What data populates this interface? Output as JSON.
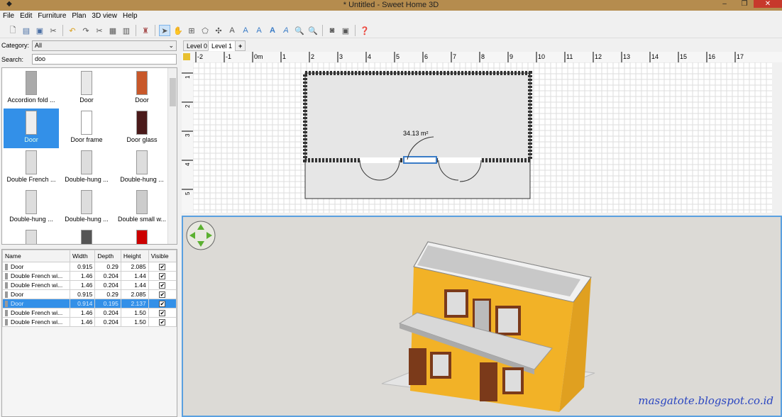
{
  "window": {
    "title": "* Untitled - Sweet Home 3D",
    "min": "–",
    "max": "❐",
    "close": "✕"
  },
  "menu": [
    "File",
    "Edit",
    "Furniture",
    "Plan",
    "3D view",
    "Help"
  ],
  "toolbar": [
    "new-icon",
    "open-icon",
    "save-icon",
    "cut-prefs-icon",
    "undo-icon",
    "redo-icon",
    "cut-icon",
    "copy-icon",
    "paste-icon",
    "add-furniture-icon",
    "select-icon",
    "pan-icon",
    "create-walls-icon",
    "create-rooms-icon",
    "create-dimensions-icon",
    "add-text-icon",
    "text-style-icon",
    "increase-text-icon",
    "bold-icon",
    "italic-icon",
    "zoom-in-icon",
    "zoom-out-icon",
    "photo-icon",
    "video-icon",
    "help-icon"
  ],
  "catalog": {
    "category_label": "Category:",
    "category_value": "All",
    "search_label": "Search:",
    "search_value": "doo",
    "items": [
      "Accordion fold ...",
      "Door",
      "Door",
      "Door",
      "Door frame",
      "Door glass",
      "Double French ...",
      "Double-hung ...",
      "Double-hung ...",
      "Double-hung ...",
      "Double-hung ...",
      "Double small w..."
    ],
    "selected_index": 3
  },
  "furniture_table": {
    "columns": [
      "Name",
      "Width",
      "Depth",
      "Height",
      "Visible"
    ],
    "rows": [
      {
        "name": "Door",
        "width": "0.915",
        "depth": "0.29",
        "height": "2.085",
        "visible": true
      },
      {
        "name": "Double French wi...",
        "width": "1.46",
        "depth": "0.204",
        "height": "1.44",
        "visible": true
      },
      {
        "name": "Double French wi...",
        "width": "1.46",
        "depth": "0.204",
        "height": "1.44",
        "visible": true
      },
      {
        "name": "Door",
        "width": "0.915",
        "depth": "0.29",
        "height": "2.085",
        "visible": true
      },
      {
        "name": "Door",
        "width": "0.914",
        "depth": "0.195",
        "height": "2.137",
        "visible": true
      },
      {
        "name": "Double French wi...",
        "width": "1.46",
        "depth": "0.204",
        "height": "1.50",
        "visible": true
      },
      {
        "name": "Double French wi...",
        "width": "1.46",
        "depth": "0.204",
        "height": "1.50",
        "visible": true
      }
    ],
    "selected_index": 4
  },
  "plan": {
    "tabs": [
      "Level 0",
      "Level 1"
    ],
    "active_tab": 1,
    "add_tab": "+",
    "ruler_x": [
      "-2",
      "-1",
      "0m",
      "1",
      "2",
      "3",
      "4",
      "5",
      "6",
      "7",
      "8",
      "9",
      "10",
      "11",
      "12",
      "13",
      "14",
      "15",
      "16",
      "17"
    ],
    "ruler_y": [
      "1",
      "2",
      "3",
      "4",
      "5"
    ],
    "room_area": "34.13 m²"
  },
  "watermark": "masgatote.blogspot.co.id"
}
